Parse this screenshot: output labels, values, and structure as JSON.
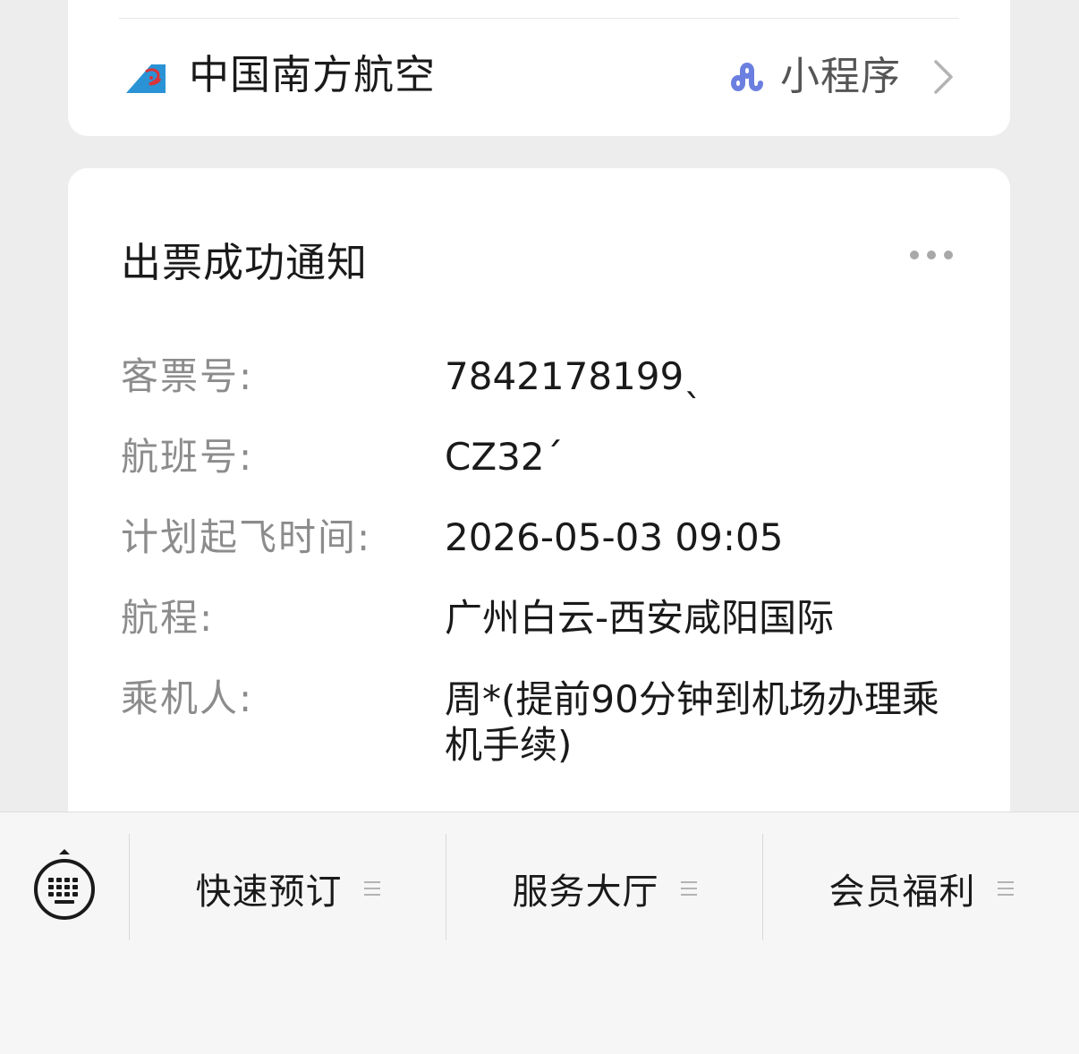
{
  "header": {
    "airline_name": "中国南方航空",
    "mini_program_label": "小程序",
    "icons": {
      "logo": "china-southern-logo-icon",
      "mini_program": "mini-program-link-icon",
      "chevron": "chevron-right-icon"
    }
  },
  "notice": {
    "title": "出票成功通知",
    "more_icon": "more-dots-icon",
    "fields": [
      {
        "label": "客票号:",
        "value": "7842178199​ˎ"
      },
      {
        "label": "航班号:",
        "value": "CZ32´"
      },
      {
        "label": "计划起飞时间:",
        "value": "2026-05-03 09:05"
      },
      {
        "label": "航程:",
        "value": "广州白云-西安咸阳国际"
      },
      {
        "label": "乘机人:",
        "value": "周*(提前90分钟到机场办理乘机手续)"
      }
    ]
  },
  "bottom_menu": {
    "keyboard_icon": "keyboard-toggle-icon",
    "items": [
      {
        "label": "快速预订",
        "icon": "menu-lines-icon"
      },
      {
        "label": "服务大厅",
        "icon": "menu-lines-icon"
      },
      {
        "label": "会员福利",
        "icon": "menu-lines-icon"
      }
    ]
  },
  "watermark": "",
  "colors": {
    "background": "#ededed",
    "card": "#ffffff",
    "label_gray": "#8c8c8c",
    "text_dark": "#1a1a1a",
    "brand_blue": "#2a93d5",
    "brand_red": "#d9343b",
    "mini_program_purple": "#6b7fe0"
  }
}
